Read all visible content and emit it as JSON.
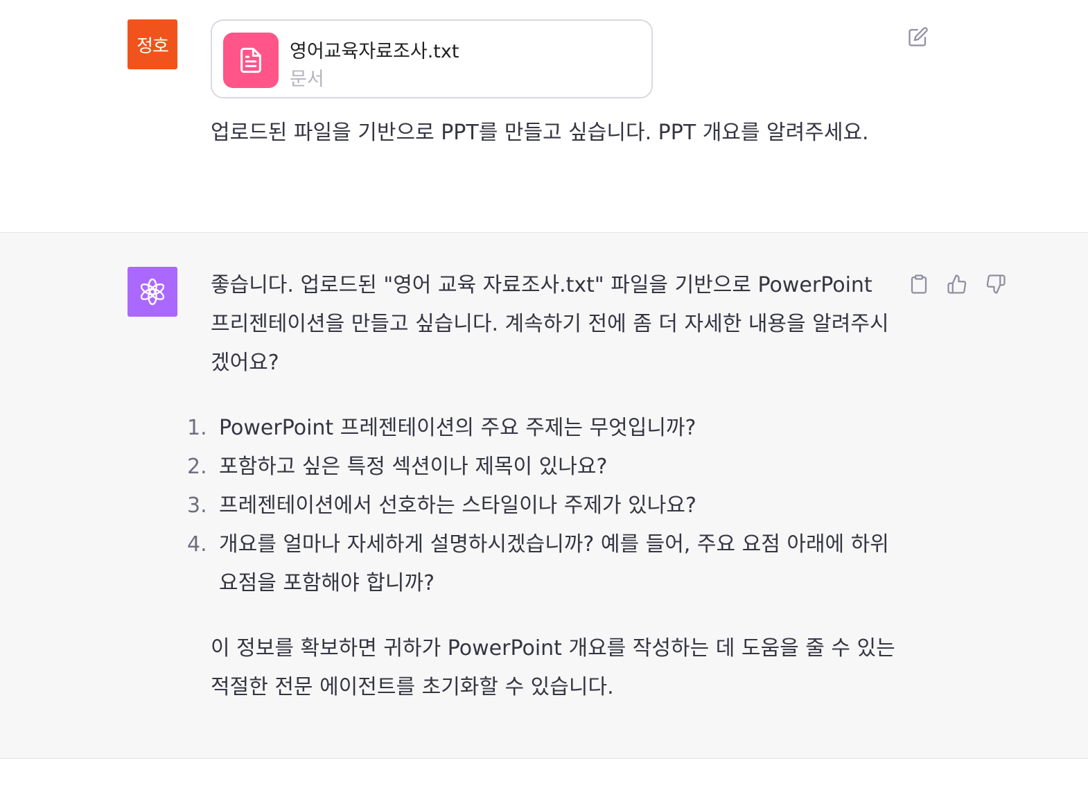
{
  "user": {
    "avatar_text": "정호",
    "attachment": {
      "file_name": "영어교육자료조사.txt",
      "file_type": "문서",
      "icon": "document-icon"
    },
    "message": "업로드된 파일을 기반으로 PPT를 만들고 싶습니다. PPT 개요를 알려주세요.",
    "edit_icon": "edit-icon"
  },
  "assistant": {
    "avatar_icon": "openai-logo",
    "intro": "좋습니다. 업로드된 \"영어 교육 자료조사.txt\" 파일을 기반으로 PowerPoint 프리젠테이션을 만들고 싶습니다. 계속하기 전에 좀 더 자세한 내용을 알려주시겠어요?",
    "questions": [
      {
        "num": "1.",
        "text": "PowerPoint 프레젠테이션의 주요 주제는 무엇입니까?"
      },
      {
        "num": "2.",
        "text": "포함하고 싶은 특정 섹션이나 제목이 있나요?"
      },
      {
        "num": "3.",
        "text": "프레젠테이션에서 선호하는 스타일이나 주제가 있나요?"
      },
      {
        "num": "4.",
        "text": "개요를 얼마나 자세하게 설명하시겠습니까? 예를 들어, 주요 요점 아래에 하위 요점을 포함해야 합니까?"
      }
    ],
    "outro": "이 정보를 확보하면 귀하가 PowerPoint 개요를 작성하는 데 도움을 줄 수 있는 적절한 전문 에이전트를 초기화할 수 있습니다.",
    "actions": [
      "clipboard-icon",
      "thumbs-up-icon",
      "thumbs-down-icon"
    ]
  },
  "colors": {
    "user_avatar": "#f0531c",
    "assistant_avatar": "#ab68ff",
    "file_icon_bg": "#ff5588",
    "assistant_bg": "#f7f7f8"
  }
}
